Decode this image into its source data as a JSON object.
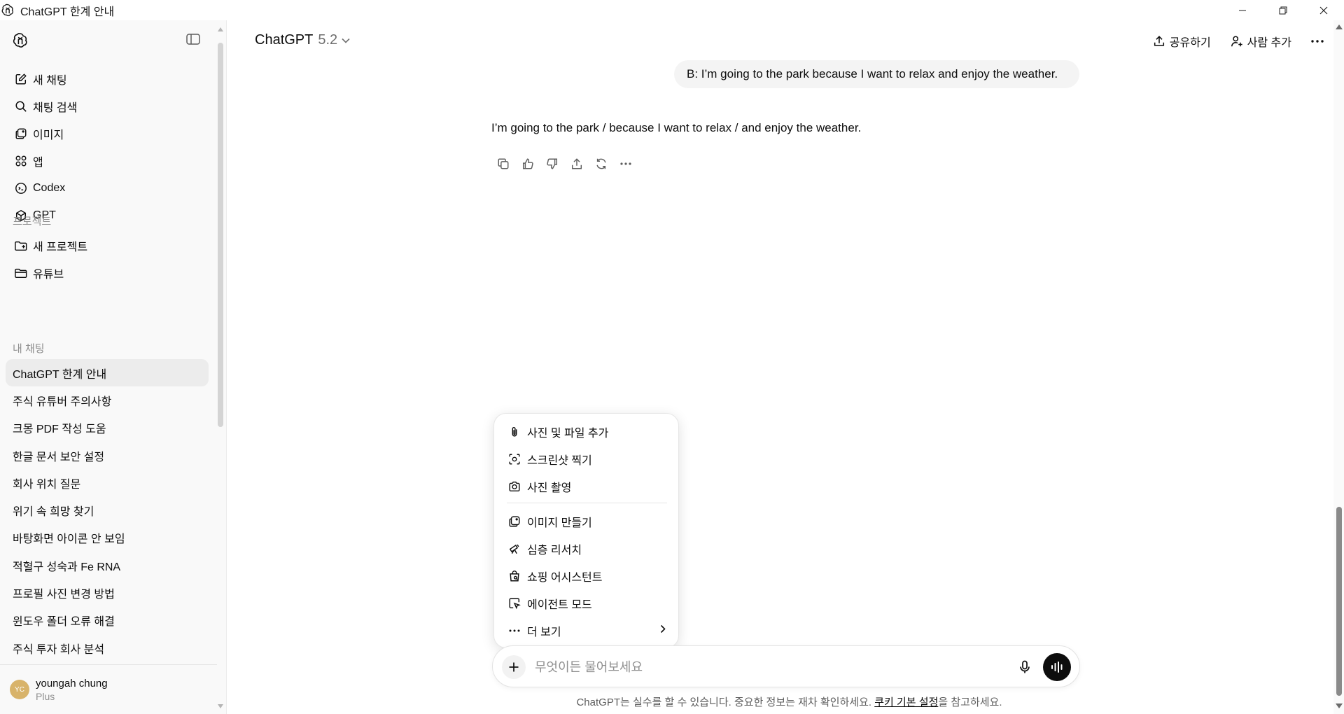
{
  "window": {
    "title": "ChatGPT 한계 안내"
  },
  "sidebar": {
    "nav": [
      {
        "label": "새 채팅",
        "icon": "compose-icon"
      },
      {
        "label": "채팅 검색",
        "icon": "search-icon"
      },
      {
        "label": "이미지",
        "icon": "image-icon"
      },
      {
        "label": "앱",
        "icon": "apps-grid-icon"
      },
      {
        "label": "Codex",
        "icon": "codex-icon"
      },
      {
        "label": "GPT",
        "icon": "cube-icon"
      }
    ],
    "projects_heading": "프로젝트",
    "projects": [
      {
        "label": "새 프로젝트",
        "icon": "new-folder-icon"
      },
      {
        "label": "유튜브",
        "icon": "folder-icon"
      }
    ],
    "chats_heading": "내 채팅",
    "chats": [
      "ChatGPT 한계 안내",
      "주식 유튜버 주의사항",
      "크몽 PDF 작성 도움",
      "한글 문서 보안 설정",
      "회사 위치 질문",
      "위기 속 희망 찾기",
      "바탕화면 아이콘 안 보임",
      "적혈구 성숙과 Fe RNA",
      "프로필 사진 변경 방법",
      "윈도우 폴더 오류 해결",
      "주식 투자 회사 분석"
    ],
    "user": {
      "initials": "YC",
      "name": "youngah chung",
      "plan": "Plus"
    }
  },
  "header": {
    "model_name": "ChatGPT",
    "model_version": "5.2",
    "share_label": "공유하기",
    "add_people_label": "사람 추가"
  },
  "conversation": {
    "user_message": "B: I’m going to the park because I want to relax and enjoy the weather.",
    "assistant_message": "I’m going to the park / because I want to relax / and enjoy the weather."
  },
  "menu": {
    "items_group1": [
      {
        "label": "사진 및 파일 추가",
        "icon": "paperclip-icon"
      },
      {
        "label": "스크린샷 찍기",
        "icon": "screenshot-icon"
      },
      {
        "label": "사진 촬영",
        "icon": "camera-icon"
      }
    ],
    "items_group2": [
      {
        "label": "이미지 만들기",
        "icon": "image-create-icon"
      },
      {
        "label": "심층 리서치",
        "icon": "telescope-icon"
      },
      {
        "label": "쇼핑 어시스턴트",
        "icon": "shopping-bag-icon"
      },
      {
        "label": "에이전트 모드",
        "icon": "agent-cursor-icon"
      }
    ],
    "more_label": "더 보기"
  },
  "composer": {
    "placeholder": "무엇이든 물어보세요"
  },
  "footer": {
    "disclaimer_prefix": "ChatGPT는 실수를 할 수 있습니다. 중요한 정보는 재차 확인하세요. ",
    "disclaimer_link": "쿠키 기본 설정",
    "disclaimer_suffix": "을 참고하세요."
  }
}
